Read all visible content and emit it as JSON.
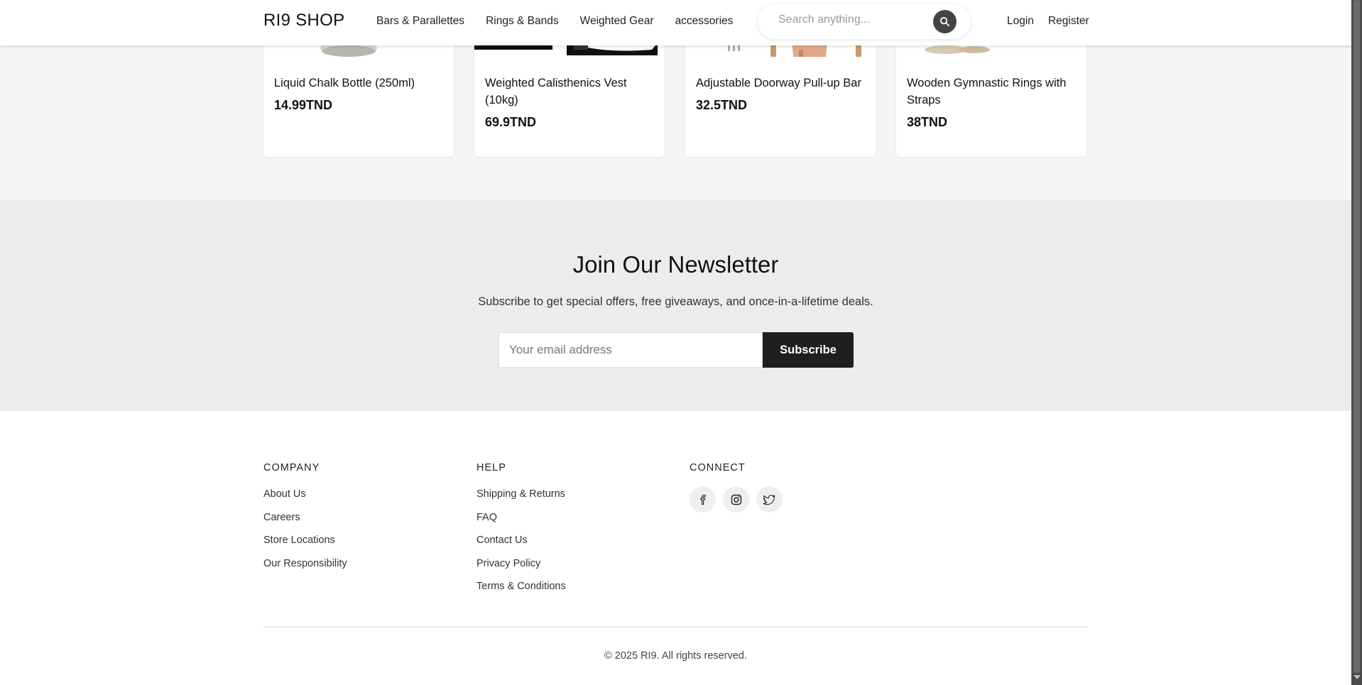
{
  "header": {
    "brand": "RI9 SHOP",
    "nav": [
      "Bars & Parallettes",
      "Rings & Bands",
      "Weighted Gear",
      "accessories"
    ],
    "search_placeholder": "Search anything...",
    "search_icon": "search-icon",
    "login": "Login",
    "register": "Register"
  },
  "products": [
    {
      "name": "Liquid Chalk Bottle (250ml)",
      "price": "14.99TND"
    },
    {
      "name": "Weighted Calisthenics Vest (10kg)",
      "price": "69.9TND"
    },
    {
      "name": "Adjustable Doorway Pull-up Bar",
      "price": "32.5TND"
    },
    {
      "name": "Wooden Gymnastic Rings with Straps",
      "price": "38TND"
    }
  ],
  "newsletter": {
    "title": "Join Our Newsletter",
    "subtitle": "Subscribe to get special offers, free giveaways, and once-in-a-lifetime deals.",
    "email_placeholder": "Your email address",
    "button": "Subscribe"
  },
  "footer": {
    "company": {
      "heading": "COMPANY",
      "links": [
        "About Us",
        "Careers",
        "Store Locations",
        "Our Responsibility"
      ]
    },
    "help": {
      "heading": "HELP",
      "links": [
        "Shipping & Returns",
        "FAQ",
        "Contact Us",
        "Privacy Policy",
        "Terms & Conditions"
      ]
    },
    "connect": {
      "heading": "CONNECT",
      "icons": [
        "facebook-icon",
        "instagram-icon",
        "twitter-icon"
      ]
    },
    "copyright": "© 2025 RI9. All rights reserved."
  }
}
